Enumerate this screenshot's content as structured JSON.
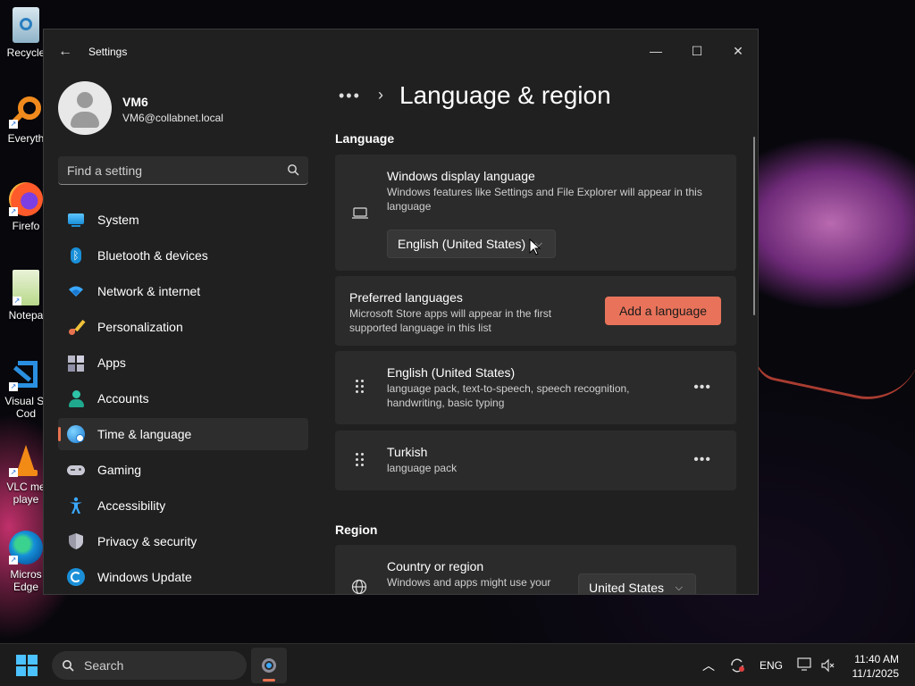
{
  "desktop": {
    "icons": [
      {
        "label": "Recycle",
        "icon": "recycle-bin-icon"
      },
      {
        "label": "Everyth",
        "icon": "everything-search-icon"
      },
      {
        "label": "Firefo",
        "icon": "firefox-icon"
      },
      {
        "label": "Notepa",
        "icon": "notepad-icon"
      },
      {
        "label": "Visual St",
        "label2": "Cod",
        "icon": "vscode-icon"
      },
      {
        "label": "VLC me",
        "label2": "playe",
        "icon": "vlc-icon"
      },
      {
        "label": "Micros",
        "label2": "Edge",
        "icon": "edge-icon"
      }
    ]
  },
  "window": {
    "app_title": "Settings",
    "controls": {
      "minimize": "—",
      "maximize": "☐",
      "close": "✕"
    }
  },
  "profile": {
    "name": "VM6",
    "email": "VM6@collabnet.local"
  },
  "search": {
    "placeholder": "Find a setting"
  },
  "nav": [
    {
      "label": "System",
      "icon": "system-icon"
    },
    {
      "label": "Bluetooth & devices",
      "icon": "bluetooth-icon"
    },
    {
      "label": "Network & internet",
      "icon": "wifi-icon"
    },
    {
      "label": "Personalization",
      "icon": "brush-icon"
    },
    {
      "label": "Apps",
      "icon": "apps-icon"
    },
    {
      "label": "Accounts",
      "icon": "account-icon"
    },
    {
      "label": "Time & language",
      "icon": "globe-clock-icon",
      "selected": true
    },
    {
      "label": "Gaming",
      "icon": "gamepad-icon"
    },
    {
      "label": "Accessibility",
      "icon": "accessibility-icon"
    },
    {
      "label": "Privacy & security",
      "icon": "shield-icon"
    },
    {
      "label": "Windows Update",
      "icon": "update-icon"
    }
  ],
  "content": {
    "breadcrumb_more": "•••",
    "breadcrumb_sep": "›",
    "page_title": "Language & region",
    "language_section": "Language",
    "display_language": {
      "title": "Windows display language",
      "desc_line1": "Windows features like Settings and File Explorer will appear in this",
      "desc_line2": "language",
      "selected": "English (United States)"
    },
    "preferred": {
      "title": "Preferred languages",
      "desc_line1": "Microsoft Store apps will appear in the first",
      "desc_line2": "supported language in this list",
      "button": "Add a language"
    },
    "languages": [
      {
        "name": "English (United States)",
        "desc_line1": "language pack, text-to-speech, speech recognition,",
        "desc_line2": "handwriting, basic typing"
      },
      {
        "name": "Turkish",
        "desc_line1": "language pack",
        "desc_line2": ""
      }
    ],
    "more_label": "•••",
    "region_section": "Region",
    "country": {
      "title": "Country or region",
      "desc_line1": "Windows and apps might use your",
      "selected": "United States"
    }
  },
  "taskbar": {
    "search_label": "Search",
    "language": "ENG",
    "time": "11:40 AM",
    "date": "11/1/2025"
  },
  "colors": {
    "accent": "#e8734f",
    "button": "#e8735a",
    "window_bg": "#202020",
    "card_bg": "#2b2b2b"
  }
}
